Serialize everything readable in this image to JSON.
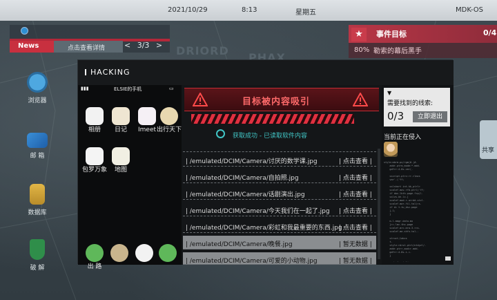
{
  "topbar": {
    "date": "2021/10/29",
    "time": "8:13",
    "weekday": "星期五",
    "os": "MDK-OS"
  },
  "background_labels": [
    "DRIORD",
    "PHAX"
  ],
  "news": {
    "tag": "News",
    "detail": "点击查看详情",
    "page": "3/3",
    "prev": "<",
    "next": ">"
  },
  "event": {
    "title": "事件目标",
    "count": "0/4",
    "percent": "80%",
    "desc": "勒索的幕后黑手"
  },
  "desktop": [
    {
      "label": "浏览器",
      "icon": "globe-icon"
    },
    {
      "label": "邮 箱",
      "icon": "mail-icon"
    },
    {
      "label": "数据库",
      "icon": "database-icon"
    },
    {
      "label": "破 解",
      "icon": "shield-icon"
    }
  ],
  "share": {
    "label": "共享"
  },
  "hacking": {
    "title": "HACKING"
  },
  "phone": {
    "owner": "ELSIE的手机",
    "apps": [
      {
        "label": "相册",
        "icon": "photos-icon",
        "color": "#f2f2f2"
      },
      {
        "label": "日记",
        "icon": "diary-icon",
        "color": "#efe6d2"
      },
      {
        "label": "Imeet",
        "icon": "imeet-icon",
        "color": "#f5f0f5"
      },
      {
        "label": "出行天下",
        "icon": "plane-icon",
        "color": "#e8d8b0"
      },
      {
        "label": "包罗万象",
        "icon": "shopping-icon",
        "color": "#f4f4f4"
      },
      {
        "label": "地图",
        "icon": "map-icon",
        "color": "#f1efe3"
      }
    ],
    "dock": [
      {
        "label": "出 路",
        "icon": "phone-call-icon",
        "color": "#5fb85a"
      },
      {
        "label": "",
        "icon": "contacts-icon",
        "color": "#c9b58d"
      },
      {
        "label": "",
        "icon": "search-app-icon",
        "color": "#f2f2f2"
      },
      {
        "label": "",
        "icon": "message-icon",
        "color": "#5fb85a"
      }
    ]
  },
  "main": {
    "alert": "目标被内容吸引",
    "success": "获取成功 - 已读取软件内容",
    "files": [
      {
        "path": "| /emulated/DCIM/Camera/讨厌的数学课.jpg",
        "action": "| 点击查看 |",
        "highlight": false
      },
      {
        "path": "| /emulated/DCIM/Camera/自拍照.jpg",
        "action": "| 点击查看 |",
        "highlight": false
      },
      {
        "path": "| /emulated/DCIM/Camera/话剧演出.jpg",
        "action": "| 点击查看 |",
        "highlight": false
      },
      {
        "path": "| /emulated/DCIM/Camera/今天我们在一起了.jpg",
        "action": "| 点击查看 |",
        "highlight": false
      },
      {
        "path": "| /emulated/DCIM/Camera/彩虹和我最重要的东西.jpg",
        "action": "| 点击查看 |",
        "highlight": false
      },
      {
        "path": "| /emulated/DCIM/Camera/晚餐.jpg",
        "action": "| 暂无数据 |",
        "highlight": true
      },
      {
        "path": "| /emulated/DCIM/Camera/可爱的小动物.jpg",
        "action": "| 暂无数据 |",
        "highlight": true
      }
    ]
  },
  "clue": {
    "toggle": "▼",
    "need": "需要找到的线索:",
    "count": "0/3",
    "exit": "立即退出",
    "invading": "当前正在侵入"
  }
}
